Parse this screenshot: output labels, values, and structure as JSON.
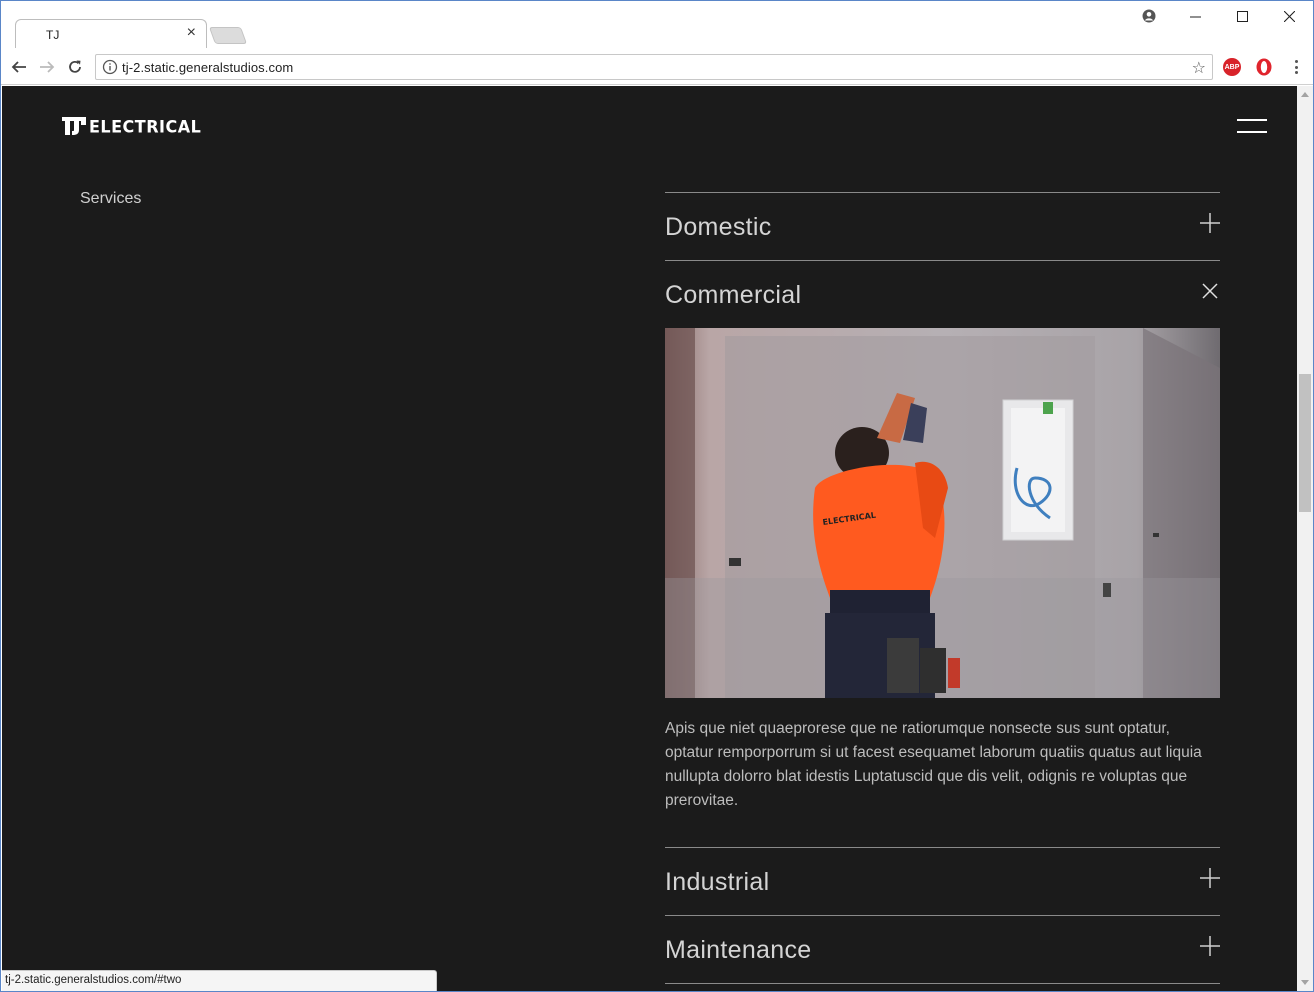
{
  "browser": {
    "tab_title": "TJ",
    "url": "tj-2.static.generalstudios.com",
    "status_url": "tj-2.static.generalstudios.com/#two"
  },
  "site": {
    "logo_text": "ELECTRICAL",
    "side_label": "Services",
    "accordion": [
      {
        "title": "Domestic",
        "state": "collapsed",
        "icon": "plus-icon"
      },
      {
        "title": "Commercial",
        "state": "expanded",
        "icon": "close-icon",
        "image_alt": "Electrician in hi-vis orange shirt working on a switchboard",
        "text": "Apis que niet quaeprorese que ne ratiorumque nonsecte sus sunt optatur, optatur remporporrum si ut facest esequamet laborum quatiis quatus aut liquia nullupta dolorro blat idestis Luptatuscid que dis velit, odignis re voluptas que prerovitae."
      },
      {
        "title": "Industrial",
        "state": "collapsed",
        "icon": "plus-icon"
      },
      {
        "title": "Maintenance",
        "state": "collapsed",
        "icon": "plus-icon"
      }
    ]
  },
  "colors": {
    "page_bg": "#1b1b1b",
    "divider": "#8a8a8a",
    "heading": "#d4d4d4",
    "body_text": "#bdbdbd",
    "hivis_orange": "#ff5a1f"
  }
}
